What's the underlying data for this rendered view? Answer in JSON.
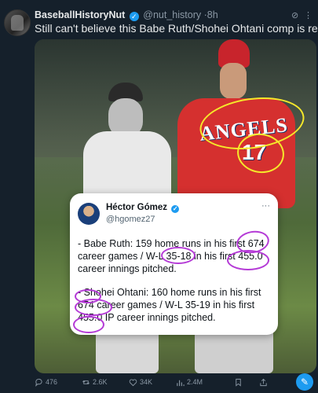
{
  "tweet": {
    "author_name": "BaseballHistoryNut",
    "author_handle": "@nut_history",
    "separator": "·",
    "time": "8h",
    "text": "Still can't believe this Babe Ruth/Shohei Ohtani comp is real."
  },
  "media": {
    "jersey_text": "ANGELS",
    "jersey_number": "17",
    "quoted_card": {
      "name": "Héctor Gómez",
      "handle": "@hgomez27",
      "more": "···",
      "paragraph1": "- Babe Ruth: 159 home runs in his first 674 career games / W-L 35-18 in his first 455.0 career innings pitched.",
      "paragraph2": "- Shohei Ohtani: 160 home runs in his first 674 career games / W-L 35-19 in his first 455.0 IP career innings pitched."
    }
  },
  "actions": {
    "replies": "476",
    "retweets": "2.6K",
    "likes": "34K",
    "views": "2.4M"
  },
  "colors": {
    "background": "#15202b",
    "accent": "#1d9bf0",
    "annotation_yellow": "#f5e82a",
    "annotation_purple": "#b43ad6"
  },
  "icons": [
    "verified-badge-icon",
    "grok-icon",
    "more-icon",
    "reply-icon",
    "retweet-icon",
    "like-icon",
    "views-icon",
    "bookmark-icon",
    "share-icon",
    "compose-icon"
  ]
}
